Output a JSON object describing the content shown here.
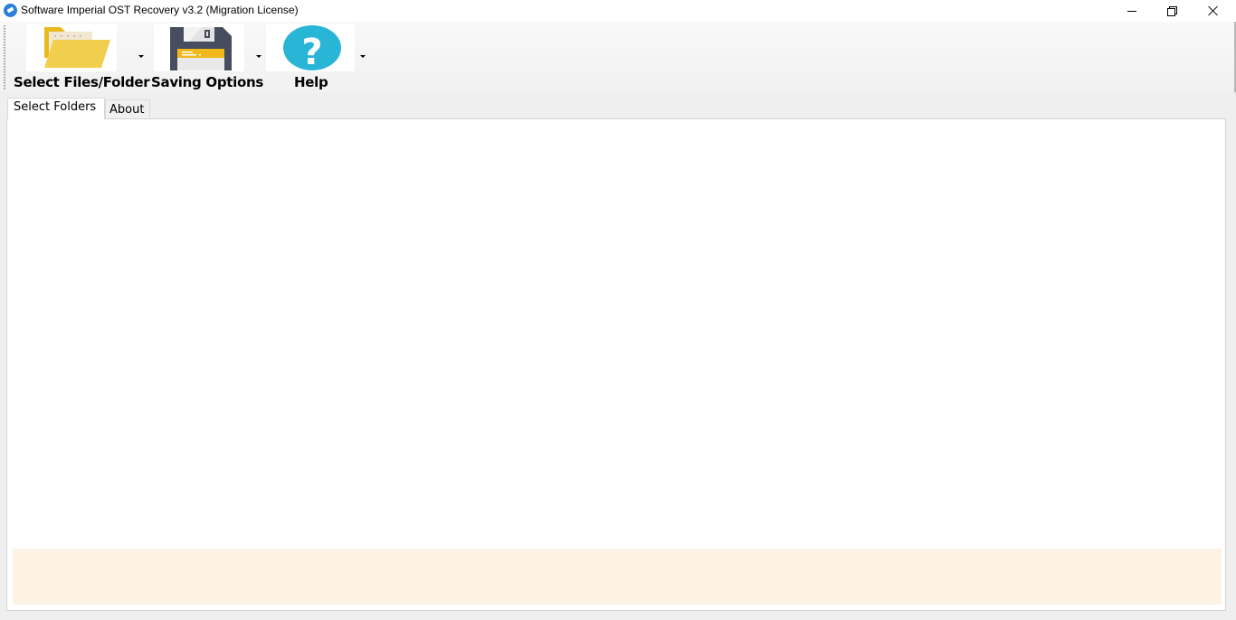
{
  "window": {
    "title": "Software Imperial OST Recovery v3.2 (Migration License)",
    "app_icon": "app-logo-icon",
    "controls": {
      "minimize": "minimize-icon",
      "maximize": "restore-icon",
      "close": "close-icon"
    }
  },
  "toolbar": {
    "items": [
      {
        "label": "Select Files/Folder",
        "icon": "folder-icon",
        "has_dropdown": true
      },
      {
        "label": "Saving Options",
        "icon": "floppy-disk-icon",
        "has_dropdown": true
      },
      {
        "label": "Help",
        "icon": "help-icon",
        "has_dropdown": true
      }
    ]
  },
  "tabs": [
    {
      "label": "Select Folders",
      "active": true
    },
    {
      "label": "About",
      "active": false
    }
  ],
  "colors": {
    "folder": "#f2ce4e",
    "floppy_body": "#454d5f",
    "floppy_label": "#f0b81b",
    "help": "#29b5d6",
    "status_area": "#fcf3e5"
  }
}
